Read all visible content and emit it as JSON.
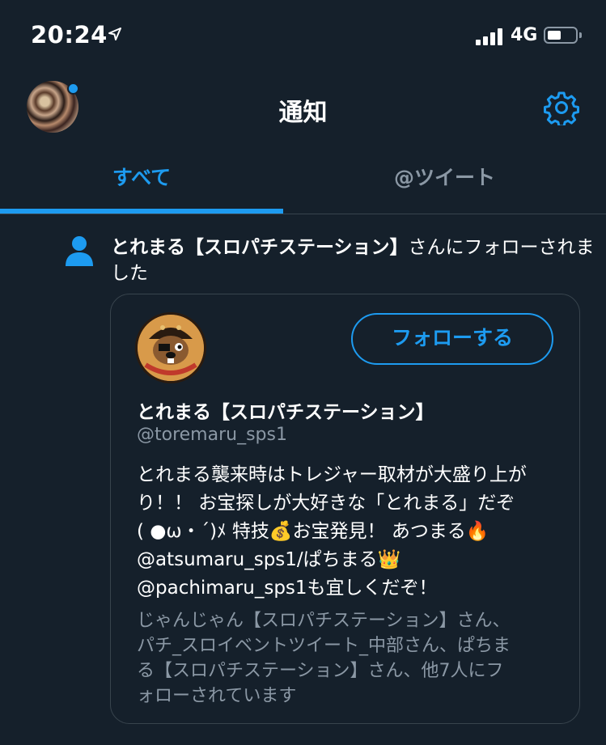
{
  "status_bar": {
    "time": "20:24",
    "network": "4G",
    "icons": [
      "location-arrow-icon",
      "signal-icon",
      "battery-icon"
    ]
  },
  "header": {
    "title": "通知",
    "settings_icon": "gear-icon"
  },
  "tabs": [
    {
      "label": "すべて",
      "active": true
    },
    {
      "label": "@ツイート",
      "active": false
    }
  ],
  "notification": {
    "icon": "person-icon",
    "actor": "とれまる【スロパチステーション】",
    "action_text": "さんにフォローされました"
  },
  "profile_card": {
    "name": "とれまる【スロパチステーション】",
    "handle": "@toremaru_sps1",
    "follow_button_label": "フォローする",
    "bio_lines": [
      "とれまる襲来時はトレジャー取材が大盛り上が",
      "り！！ お宝探しが大好きな「とれまる」だぞ",
      "( ●ω・´)ﾒ 特技💰お宝発見！ あつまる🔥",
      "@atsumaru_sps1/ぱちまる👑",
      "@pachimaru_sps1も宜しくだぞ！"
    ],
    "followed_by_lines": [
      "じゃんじゃん【スロパチステーション】さん、",
      "パチ_スロイベントツイート_中部さん、ぱちま",
      "る【スロパチステーション】さん、他7人にフ",
      "ォローされています"
    ]
  },
  "colors": {
    "background": "#15202b",
    "accent": "#1d9bf0",
    "secondary_text": "#8b98a5",
    "border": "#38444d"
  }
}
